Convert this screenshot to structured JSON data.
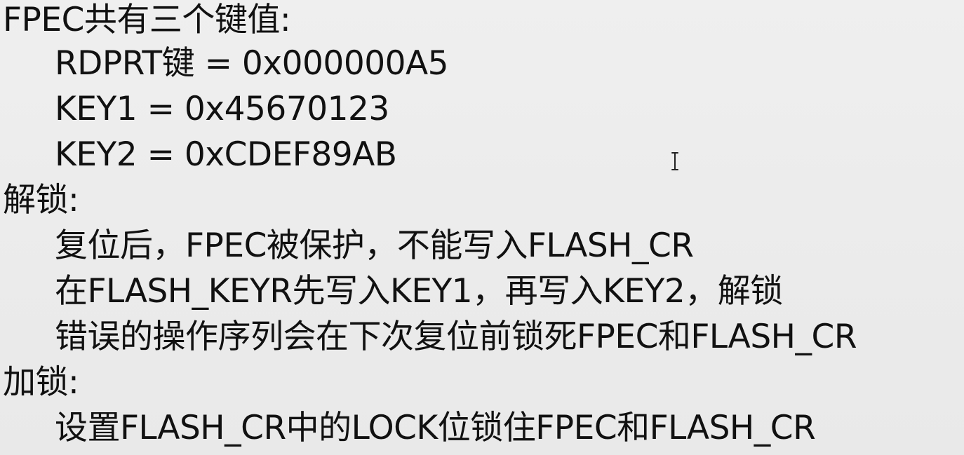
{
  "sections": [
    {
      "heading": "FPEC共有三个键值:",
      "items": [
        "RDPRT键 = 0x000000A5",
        "KEY1 = 0x45670123",
        "KEY2 = 0xCDEF89AB"
      ]
    },
    {
      "heading": "解锁:",
      "items": [
        "复位后，FPEC被保护，不能写入FLASH_CR",
        "在FLASH_KEYR先写入KEY1，再写入KEY2，解锁",
        "错误的操作序列会在下次复位前锁死FPEC和FLASH_CR"
      ]
    },
    {
      "heading": "加锁:",
      "items": [
        "设置FLASH_CR中的LOCK位锁住FPEC和FLASH_CR"
      ]
    }
  ],
  "colors": {
    "background": "#ececec",
    "text": "#111111"
  },
  "icons": {
    "cursor": "text-cursor-icon"
  }
}
